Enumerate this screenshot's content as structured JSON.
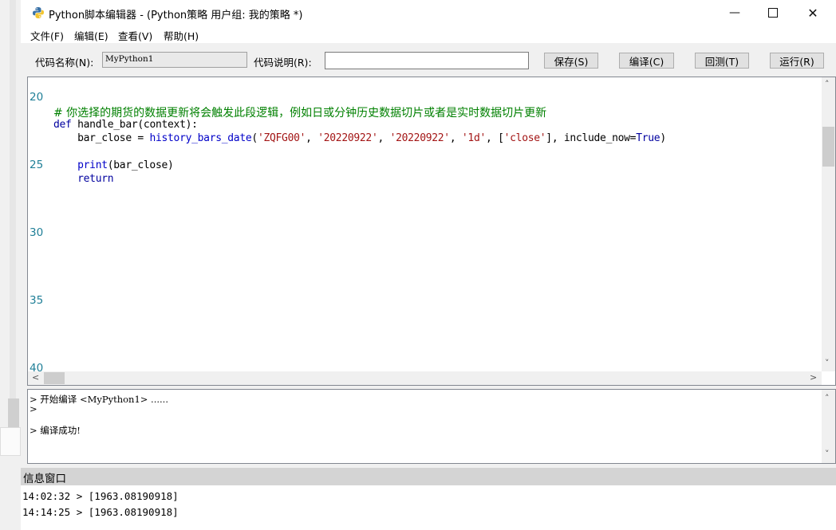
{
  "window": {
    "title": "Python脚本编辑器 - (Python策略 用户组: 我的策略 *)"
  },
  "menu": [
    "文件(F)",
    "编辑(E)",
    "查看(V)",
    "帮助(H)"
  ],
  "toolbar": {
    "name_label": "代码名称(N):",
    "name_value": "MyPython1",
    "desc_label": "代码说明(R):",
    "desc_value": "",
    "save": "保存(S)",
    "compile": "编译(C)",
    "rollback": "回测(T)",
    "run": "运行(R)"
  },
  "editor": {
    "line_numbers": [
      "20",
      "25",
      "30",
      "35",
      "40"
    ],
    "code": {
      "comment": "# 你选择的期货的数据更新将会触发此段逻辑，例如日或分钟历史数据切片或者是实时数据切片更新",
      "def_kw": "def",
      "def_rest": " handle_bar(context):",
      "l3_a": "    bar_close = ",
      "l3_fn": "history_bars_date",
      "l3_b": "(",
      "l3_s1": "'ZQFG00'",
      "l3_c": ", ",
      "l3_s2": "'20220922'",
      "l3_d": ", ",
      "l3_s3": "'20220922'",
      "l3_e": ", ",
      "l3_s4": "'1d'",
      "l3_f": ", [",
      "l3_s5": "'close'",
      "l3_g": "], include_now=",
      "l3_true": "True",
      "l3_h": ")",
      "print_kw": "print",
      "print_rest": "(bar_close)",
      "return_kw": "return"
    }
  },
  "output": {
    "lines": [
      "> 开始编译 <MyPython1> ......",
      ">",
      "> 编译成功!"
    ]
  },
  "info": {
    "title": "信息窗口",
    "lines": [
      "14:02:32 > [1963.08190918]",
      "14:14:25 > [1963.08190918]"
    ]
  }
}
